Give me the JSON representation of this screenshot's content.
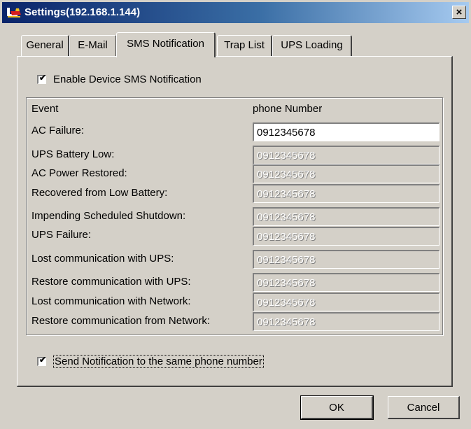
{
  "window": {
    "title": "Settings(192.168.1.144)",
    "close_glyph": "×"
  },
  "tabs": [
    {
      "label": "General",
      "selected": false
    },
    {
      "label": "E-Mail",
      "selected": false
    },
    {
      "label": "SMS Notification",
      "selected": true
    },
    {
      "label": "Trap List",
      "selected": false
    },
    {
      "label": "UPS Loading",
      "selected": false
    }
  ],
  "sms": {
    "enable_label": "Enable Device SMS Notification",
    "enable_checked": true,
    "event_header": "Event",
    "phone_header": "phone Number",
    "events": [
      {
        "label": "AC Failure:",
        "phone": "0912345678",
        "enabled": true
      },
      {
        "label": "UPS Battery Low:",
        "phone": "0912345678",
        "enabled": false
      },
      {
        "label": "AC Power Restored:",
        "phone": "0912345678",
        "enabled": false
      },
      {
        "label": "Recovered from Low Battery:",
        "phone": "0912345678",
        "enabled": false
      },
      {
        "label": "Impending Scheduled Shutdown:",
        "phone": "0912345678",
        "enabled": false
      },
      {
        "label": "UPS Failure:",
        "phone": "0912345678",
        "enabled": false
      },
      {
        "label": "Lost communication with UPS:",
        "phone": "0912345678",
        "enabled": false
      },
      {
        "label": "Restore communication with UPS:",
        "phone": "0912345678",
        "enabled": false
      },
      {
        "label": "Lost communication with Network:",
        "phone": "0912345678",
        "enabled": false
      },
      {
        "label": "Restore communication from Network:",
        "phone": "0912345678",
        "enabled": false
      }
    ],
    "same_number_label": "Send Notification to the same phone number",
    "same_number_checked": true
  },
  "buttons": {
    "ok": "OK",
    "cancel": "Cancel"
  },
  "colors": {
    "face": "#d4d0c8",
    "title_start": "#0a246a",
    "title_end": "#a6caf0"
  }
}
